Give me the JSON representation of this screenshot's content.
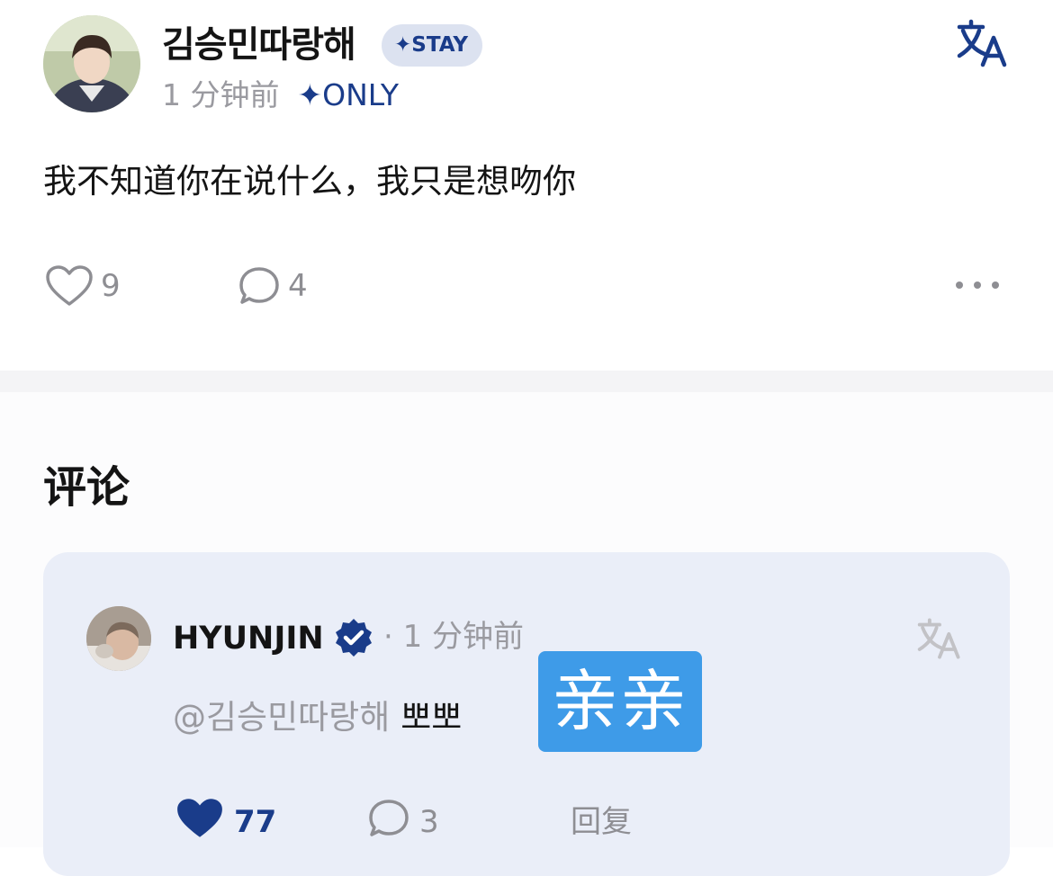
{
  "post": {
    "author": "김승민따랑해",
    "badge": "✦STAY",
    "time": "1 分钟前",
    "visibility": "✦ONLY",
    "text": "我不知道你在说什么，我只是想吻你",
    "likes": "9",
    "comments": "4"
  },
  "comments_section": {
    "title": "评论",
    "items": [
      {
        "author": "HYUNJIN",
        "time": "· 1 分钟前",
        "mention": "@김승민따랑해",
        "text": "뽀뽀",
        "translation": "亲亲",
        "likes": "77",
        "replies": "3",
        "reply_label": "回复"
      }
    ]
  },
  "colors": {
    "accent_blue": "#1a3c8a",
    "translation_overlay": "#3e9be8",
    "comment_card": "#eaeef8"
  },
  "icons": {
    "like": "heart-outline-icon",
    "liked": "heart-filled-icon",
    "comment": "speech-bubble-icon",
    "more": "more-dots-icon",
    "translate": "translate-icon",
    "verified": "verified-badge-icon"
  }
}
